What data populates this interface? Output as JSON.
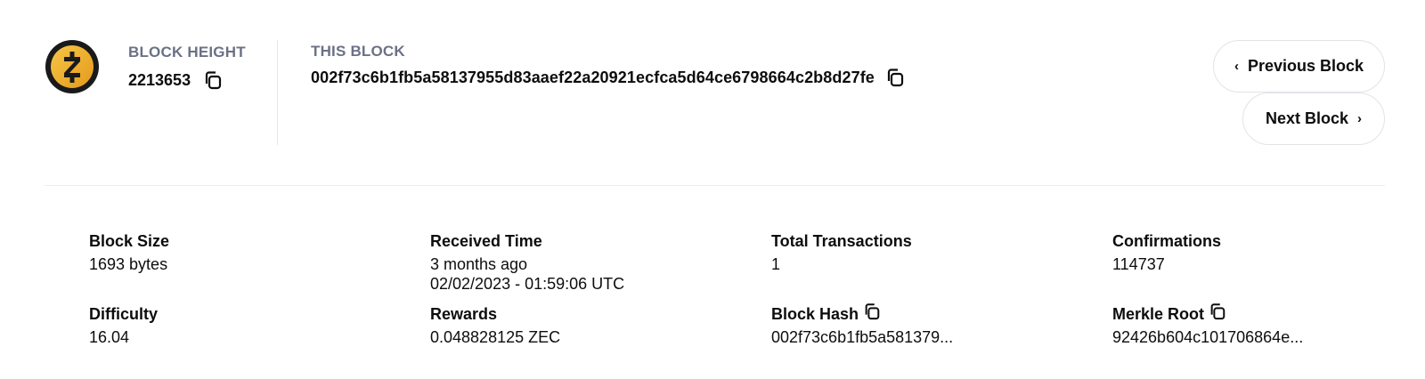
{
  "block_height": {
    "label": "BLOCK HEIGHT",
    "value": "2213653"
  },
  "this_block": {
    "label": "THIS BLOCK",
    "hash": "002f73c6b1fb5a58137955d83aaef22a20921ecfca5d64ce6798664c2b8d27fe"
  },
  "nav": {
    "previous_label": "Previous Block",
    "next_label": "Next Block"
  },
  "stats": {
    "block_size": {
      "title": "Block Size",
      "value": "1693 bytes"
    },
    "received_time": {
      "title": "Received Time",
      "relative": "3 months ago",
      "absolute": "02/02/2023 - 01:59:06 UTC"
    },
    "total_transactions": {
      "title": "Total Transactions",
      "value": "1"
    },
    "confirmations": {
      "title": "Confirmations",
      "value": "114737"
    },
    "difficulty": {
      "title": "Difficulty",
      "value": "16.04"
    },
    "rewards": {
      "title": "Rewards",
      "value": "0.048828125 ZEC"
    },
    "block_hash": {
      "title": "Block Hash",
      "value": "002f73c6b1fb5a581379..."
    },
    "merkle_root": {
      "title": "Merkle Root",
      "value": "92426b604c101706864e..."
    }
  },
  "icons": {
    "logo": "zcash-logo",
    "copy": "copy-icon",
    "chevron_left": "chevron-left-icon",
    "chevron_right": "chevron-right-icon"
  },
  "colors": {
    "logo_gold": "#f4b728",
    "logo_dark": "#1a1a1a",
    "muted_label": "#6b7186",
    "divider": "#e6e6ea"
  }
}
